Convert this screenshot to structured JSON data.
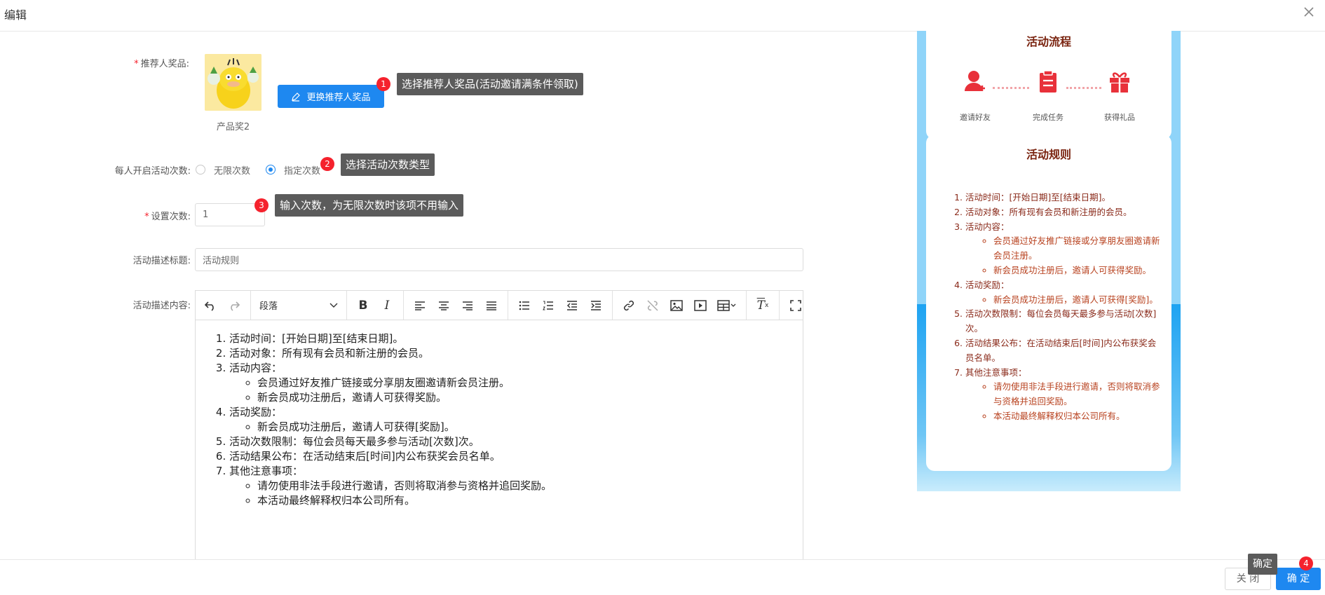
{
  "header": {
    "title": "编辑"
  },
  "form": {
    "prize_label": "推荐人奖品:",
    "prize_name": "产品奖2",
    "change_prize_button": "更换推荐人奖品",
    "times_type_label": "每人开启活动次数:",
    "radio_unlimited": "无限次数",
    "radio_specified": "指定次数",
    "set_count_label": "设置次数:",
    "set_count_value": "1",
    "desc_title_label": "活动描述标题:",
    "desc_title_value": "活动规则",
    "desc_content_label": "活动描述内容:"
  },
  "tooltips": {
    "t1": {
      "num": "1",
      "text": "选择推荐人奖品(活动邀请满条件领取)"
    },
    "t2": {
      "num": "2",
      "text": "选择活动次数类型"
    },
    "t3": {
      "num": "3",
      "text": "输入次数，为无限次数时该项不用输入"
    },
    "t4": {
      "num": "4",
      "text": "确定"
    }
  },
  "editor": {
    "paragraph_select": "段落",
    "toolbar_icons": [
      "undo-icon",
      "redo-icon",
      "bold-icon",
      "italic-icon",
      "align-left-icon",
      "align-center-icon",
      "align-right-icon",
      "align-justify-icon",
      "bullet-list-icon",
      "numbered-list-icon",
      "outdent-icon",
      "indent-icon",
      "link-icon",
      "unlink-icon",
      "image-icon",
      "video-icon",
      "table-icon",
      "clear-format-icon",
      "fullscreen-icon"
    ],
    "content": {
      "i1": "活动时间：[开始日期]至[结束日期]。",
      "i2": "活动对象：所有现有会员和新注册的会员。",
      "i3": "活动内容：",
      "i3a": "会员通过好友推广链接或分享朋友圈邀请新会员注册。",
      "i3b": "新会员成功注册后，邀请人可获得奖励。",
      "i4": "活动奖励：",
      "i4a": "新会员成功注册后，邀请人可获得[奖励]。",
      "i5": "活动次数限制：每位会员每天最多参与活动[次数]次。",
      "i6": "活动结果公布：在活动结束后[时间]内公布获奖会员名单。",
      "i7": "其他注意事项：",
      "i7a": "请勿使用非法手段进行邀请，否则将取消参与资格并追回奖励。",
      "i7b": "本活动最终解释权归本公司所有。"
    }
  },
  "preview": {
    "flow_title": "活动流程",
    "steps": [
      "邀请好友",
      "完成任务",
      "获得礼品"
    ],
    "rules_title": "活动规则",
    "rules": {
      "r1": "活动时间：[开始日期]至[结束日期]。",
      "r2": "活动对象：所有现有会员和新注册的会员。",
      "r3": "活动内容：",
      "r3a": "会员通过好友推广链接或分享朋友圈邀请新会员注册。",
      "r3b": "新会员成功注册后，邀请人可获得奖励。",
      "r4": "活动奖励：",
      "r4a": "新会员成功注册后，邀请人可获得[奖励]。",
      "r5": "活动次数限制：每位会员每天最多参与活动[次数]次。",
      "r6": "活动结果公布：在活动结束后[时间]内公布获奖会员名单。",
      "r7": "其他注意事项：",
      "r7a": "请勿使用非法手段进行邀请，否则将取消参与资格并追回奖励。",
      "r7b": "本活动最终解释权归本公司所有。"
    }
  },
  "footer": {
    "close_button": "关 闭",
    "ok_button": "确 定"
  },
  "colors": {
    "primary": "#1e88f0",
    "badge": "#f5222d",
    "tooltip": "#5b5b5b",
    "preview_bg": "#8fd4f9",
    "rules_text": "#8a2a1a"
  }
}
